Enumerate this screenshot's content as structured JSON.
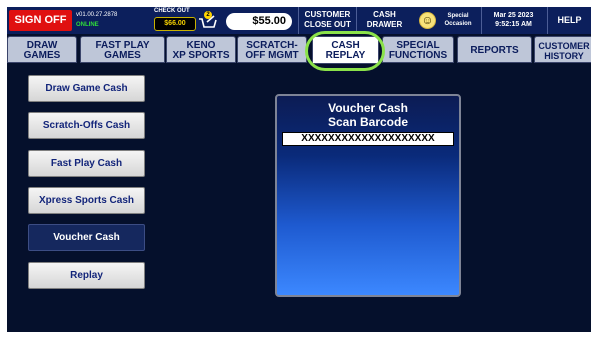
{
  "topbar": {
    "sign_off": "SIGN OFF",
    "version": "v01.00.27.2878",
    "status": "ONLINE",
    "checkout_label": "CHECK OUT",
    "checkout_amount": "$66.00",
    "cart_count": "2",
    "total": "$55.00",
    "customer_close_out": [
      "CUSTOMER",
      "CLOSE OUT"
    ],
    "cash_drawer": [
      "CASH",
      "DRAWER"
    ],
    "special_occasion": [
      "Special",
      "Occasion"
    ],
    "date": "Mar 25 2023",
    "time": "9:52:15 AM",
    "help": "HELP"
  },
  "tabs": [
    {
      "line1": "DRAW",
      "line2": "GAMES"
    },
    {
      "line1": "FAST PLAY",
      "line2": "GAMES"
    },
    {
      "line1": "KENO",
      "line2": "XP SPORTS"
    },
    {
      "line1": "SCRATCH-",
      "line2": "OFF MGMT"
    },
    {
      "line1": "CASH",
      "line2": "REPLAY",
      "active": true
    },
    {
      "line1": "SPECIAL",
      "line2": "FUNCTIONS"
    },
    {
      "line1": "REPORTS",
      "line2": ""
    },
    {
      "line1": "CUSTOMER",
      "line2": "HISTORY"
    }
  ],
  "menu": [
    {
      "label": "Draw Game Cash"
    },
    {
      "label": "Scratch-Offs Cash"
    },
    {
      "label": "Fast Play Cash"
    },
    {
      "label": "Xpress Sports Cash"
    },
    {
      "label": "Voucher Cash",
      "selected": true
    },
    {
      "label": "Replay"
    }
  ],
  "panel": {
    "title": "Voucher Cash",
    "subtitle": "Scan Barcode",
    "barcode_value": "XXXXXXXXXXXXXXXXXXXX"
  },
  "colors": {
    "screen_bg": "#05102c",
    "sign_off": "#e01010",
    "highlight_ring": "#8be24a",
    "online": "#2fdb3a"
  }
}
